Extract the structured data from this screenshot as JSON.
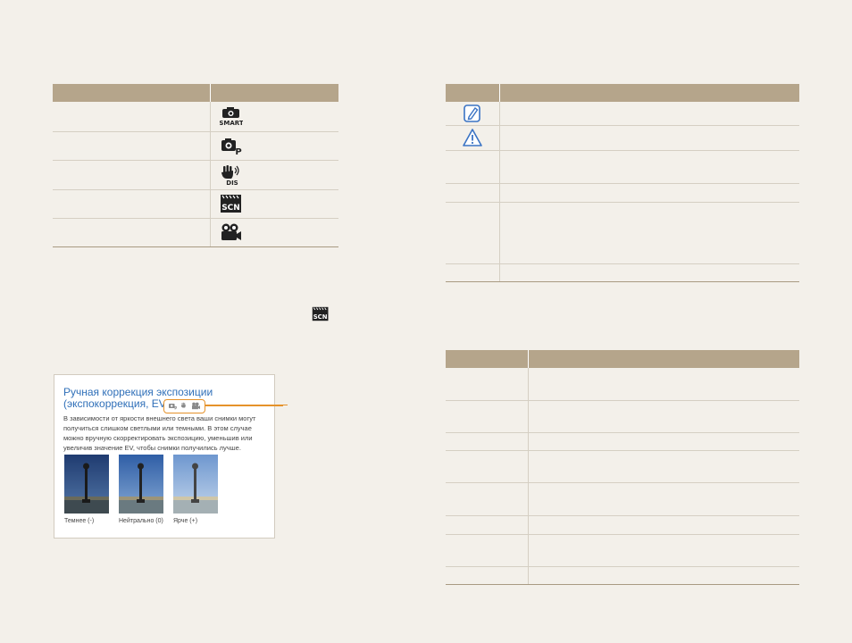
{
  "modes_table": {
    "headers": [
      "",
      ""
    ],
    "rows": [
      {
        "label": "",
        "icon": "smart-mode-icon"
      },
      {
        "label": "",
        "icon": "program-mode-icon"
      },
      {
        "label": "",
        "icon": "dual-is-mode-icon"
      },
      {
        "label": "",
        "icon": "scene-mode-icon"
      },
      {
        "label": "",
        "icon": "movie-mode-icon"
      }
    ]
  },
  "inline_icon": "scene-mode-icon",
  "icons_table": {
    "headers": [
      "",
      ""
    ],
    "rows": [
      {
        "icon": "note-icon",
        "text": ""
      },
      {
        "icon": "warning-icon",
        "text": ""
      },
      {
        "icon": "",
        "text": ""
      },
      {
        "icon": "",
        "text": ""
      },
      {
        "icon": "",
        "text": ""
      },
      {
        "icon": "",
        "text": ""
      }
    ]
  },
  "third_table": {
    "headers": [
      "",
      ""
    ],
    "rows": [
      {
        "a": "",
        "b": ""
      },
      {
        "a": "",
        "b": ""
      },
      {
        "a": "",
        "b": ""
      },
      {
        "a": "",
        "b": ""
      },
      {
        "a": "",
        "b": ""
      },
      {
        "a": "",
        "b": ""
      },
      {
        "a": "",
        "b": ""
      },
      {
        "a": "",
        "b": ""
      }
    ]
  },
  "sample": {
    "title_line1": "Ручная коррекция экспозиции",
    "title_line2": "(экспокоррекция, EV)",
    "mode_icons": [
      "program-icon",
      "dual-is-icon",
      "movie-icon"
    ],
    "paragraph": "В зависимости от яркости внешнего света ваши снимки могут получиться слишком светлыми или темными. В этом случае можно вручную скорректировать экспозицию, уменьшив или увеличив значение EV, чтобы снимки получились лучше.",
    "captions": [
      "Темнее (-)",
      "Нейтрально (0)",
      "Ярче (+)"
    ]
  },
  "colors": {
    "page_bg": "#f3f0ea",
    "header_bg": "#b5a58b",
    "title_blue": "#2f6fb8",
    "callout_orange": "#e5922a"
  }
}
